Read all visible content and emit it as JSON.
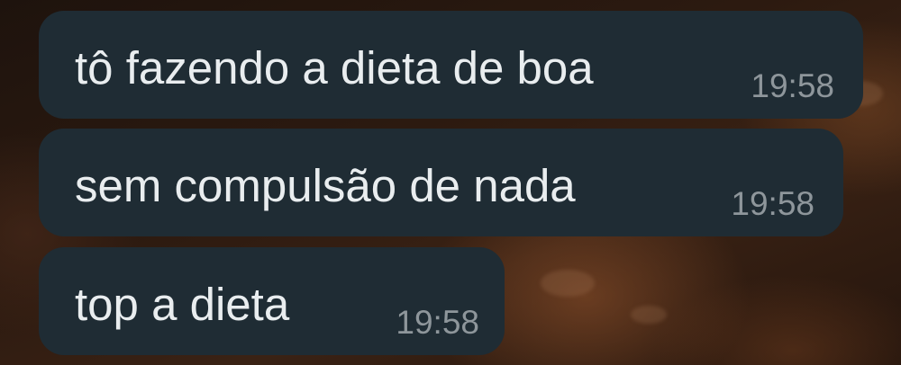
{
  "messages": [
    {
      "text": "tô fazendo a dieta de boa",
      "time": "19:58"
    },
    {
      "text": "sem compulsão de nada",
      "time": "19:58"
    },
    {
      "text": "top a dieta",
      "time": "19:58"
    }
  ],
  "colors": {
    "bubble": "#1f2c34",
    "text": "#e9edef",
    "timestamp": "#8e969b"
  }
}
